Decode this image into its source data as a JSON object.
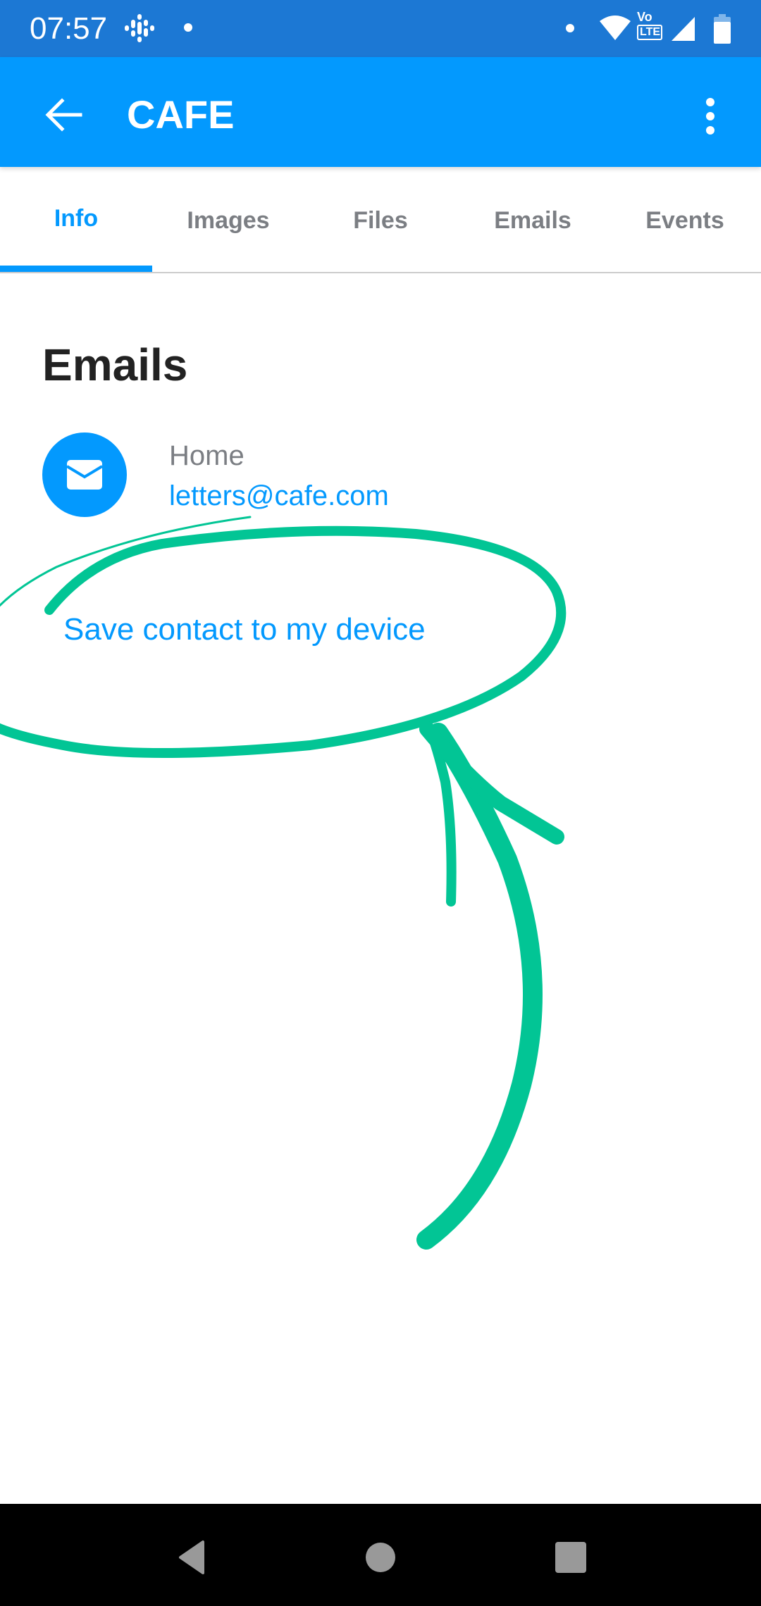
{
  "status_bar": {
    "time": "07:57",
    "left_icons": [
      "podcasts-icon",
      "notification-dot-icon"
    ],
    "right_icons": [
      "notification-dot-icon",
      "wifi-icon",
      "volte-icon",
      "cellular-signal-icon",
      "battery-icon"
    ],
    "volte_text_top": "Vo",
    "volte_text_bottom": "LTE"
  },
  "app_bar": {
    "title": "CAFE",
    "back_icon": "arrow-left-icon",
    "menu_icon": "more-vertical-icon"
  },
  "tabs": [
    {
      "label": "Info",
      "active": true
    },
    {
      "label": "Images",
      "active": false
    },
    {
      "label": "Files",
      "active": false
    },
    {
      "label": "Emails",
      "active": false
    },
    {
      "label": "Events",
      "active": false
    }
  ],
  "content": {
    "section_title": "Emails",
    "emails": [
      {
        "icon": "mail-icon",
        "label": "Home",
        "address": "letters@cafe.com"
      }
    ],
    "save_contact_label": "Save contact to my device"
  },
  "annotation": {
    "color": "#02c595",
    "shapes": [
      "ellipse-highlight",
      "curved-arrow"
    ]
  },
  "colors": {
    "status_bar": "#1c78d4",
    "primary": "#0399fe",
    "title_text": "#222222",
    "secondary_text": "#7b7e83"
  },
  "nav_bar": {
    "buttons": [
      "back-triangle-icon",
      "home-circle-icon",
      "recents-square-icon"
    ]
  }
}
